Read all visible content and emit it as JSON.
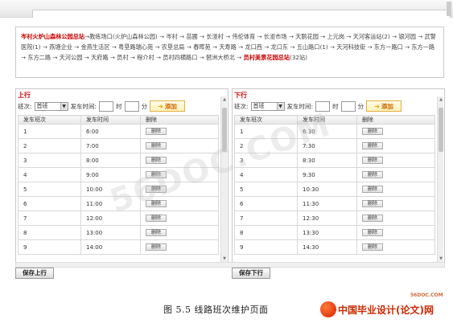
{
  "route": {
    "start": "岑村火炉山森林公园总站",
    "middle": "→教练场口(火炉山森林公园) → 岑村 → 苗圃 → 长湴村 → 伟伦体育 → 长湴市场 → 天鹅花园 → 上元岗 → 天河客运站(2) → 银河园 → 武警医院(1) → 燕塘企业 → 金燕生活区 → 粤垦路瑞心苑 → 农垦总局 → 春晖苑 → 天寿路 → 龙口西 → 龙口东 → 五山路口(1) → 天河科技街 → 东方一路口 → 东方一路 → 东方二路 → 天河公园 → 天府路 → 员村 → 程介村 → 员村四横路口 → 琶洲大桥北 → ",
    "end": "员村美景花园总站",
    "count": "(32站)"
  },
  "panels": [
    {
      "title": "上行",
      "shift_label": "班次:",
      "shift_value": "首班",
      "time_label": "发车时间:",
      "hour_label": "时",
      "minute_label": "分",
      "add_label": "添加",
      "columns": [
        "发车班次",
        "发车时间",
        "删除"
      ],
      "rows": [
        {
          "no": "1",
          "time": "6:00",
          "del": "删除"
        },
        {
          "no": "2",
          "time": "7:00",
          "del": "删除"
        },
        {
          "no": "3",
          "time": "8:00",
          "del": "删除"
        },
        {
          "no": "4",
          "time": "9:00",
          "del": "删除"
        },
        {
          "no": "5",
          "time": "10:00",
          "del": "删除"
        },
        {
          "no": "6",
          "time": "11:00",
          "del": "删除"
        },
        {
          "no": "7",
          "time": "12:00",
          "del": "删除"
        },
        {
          "no": "8",
          "time": "13:00",
          "del": "删除"
        },
        {
          "no": "9",
          "time": "14:00",
          "del": "删除"
        }
      ],
      "save_label": "保存上行"
    },
    {
      "title": "下行",
      "shift_label": "班次:",
      "shift_value": "首班",
      "time_label": "发车时间:",
      "hour_label": "时",
      "minute_label": "分",
      "add_label": "添加",
      "columns": [
        "发车班次",
        "发车时间",
        "删除"
      ],
      "rows": [
        {
          "no": "1",
          "time": "6:30",
          "del": "删除"
        },
        {
          "no": "2",
          "time": "7:30",
          "del": "删除"
        },
        {
          "no": "3",
          "time": "8:30",
          "del": "删除"
        },
        {
          "no": "4",
          "time": "9:30",
          "del": "删除"
        },
        {
          "no": "5",
          "time": "10:30",
          "del": "删除"
        },
        {
          "no": "6",
          "time": "11:30",
          "del": "删除"
        },
        {
          "no": "7",
          "time": "12:30",
          "del": "删除"
        },
        {
          "no": "8",
          "time": "13:30",
          "del": "删除"
        },
        {
          "no": "9",
          "time": "14:30",
          "del": "删除"
        }
      ],
      "save_label": "保存下行"
    }
  ],
  "caption": "图 5.5  线路班次维护页面",
  "footer": {
    "brand": "中国毕业设计(论文)网",
    "site": "56DOC.COM"
  },
  "watermark": "56DOC.COM",
  "colors": {
    "accent_red": "#cc0000",
    "add_button_text": "#cc6600"
  }
}
